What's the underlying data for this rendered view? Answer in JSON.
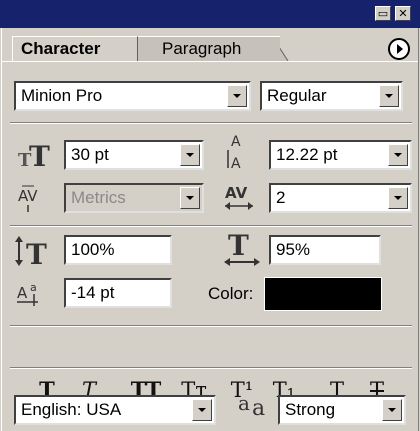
{
  "window": {
    "minimize_glyph": "▭",
    "close_glyph": "✕"
  },
  "tabs": {
    "active": "Character",
    "inactive": "Paragraph"
  },
  "font": {
    "family": "Minion Pro",
    "style": "Regular"
  },
  "size": {
    "value": "30 pt"
  },
  "leading": {
    "value": "12.22 pt"
  },
  "kerning": {
    "value": "Metrics"
  },
  "tracking": {
    "value": "2"
  },
  "vertical_scale": {
    "value": "100%"
  },
  "horizontal_scale": {
    "value": "95%"
  },
  "baseline_shift": {
    "value": "-14 pt"
  },
  "color": {
    "label": "Color:",
    "swatch": "#000000"
  },
  "style_buttons": [
    {
      "name": "faux-bold",
      "glyph": "T"
    },
    {
      "name": "faux-italic",
      "glyph": "T"
    },
    {
      "name": "all-caps",
      "glyph": "TT"
    },
    {
      "name": "small-caps",
      "glyph": "Tт"
    },
    {
      "name": "superscript",
      "glyph": "T¹"
    },
    {
      "name": "subscript",
      "glyph": "T₁"
    },
    {
      "name": "underline",
      "glyph": "T"
    },
    {
      "name": "strikethrough",
      "glyph": "T"
    }
  ],
  "language": {
    "value": "English: USA"
  },
  "antialias": {
    "icon": "aa",
    "value": "Strong"
  }
}
